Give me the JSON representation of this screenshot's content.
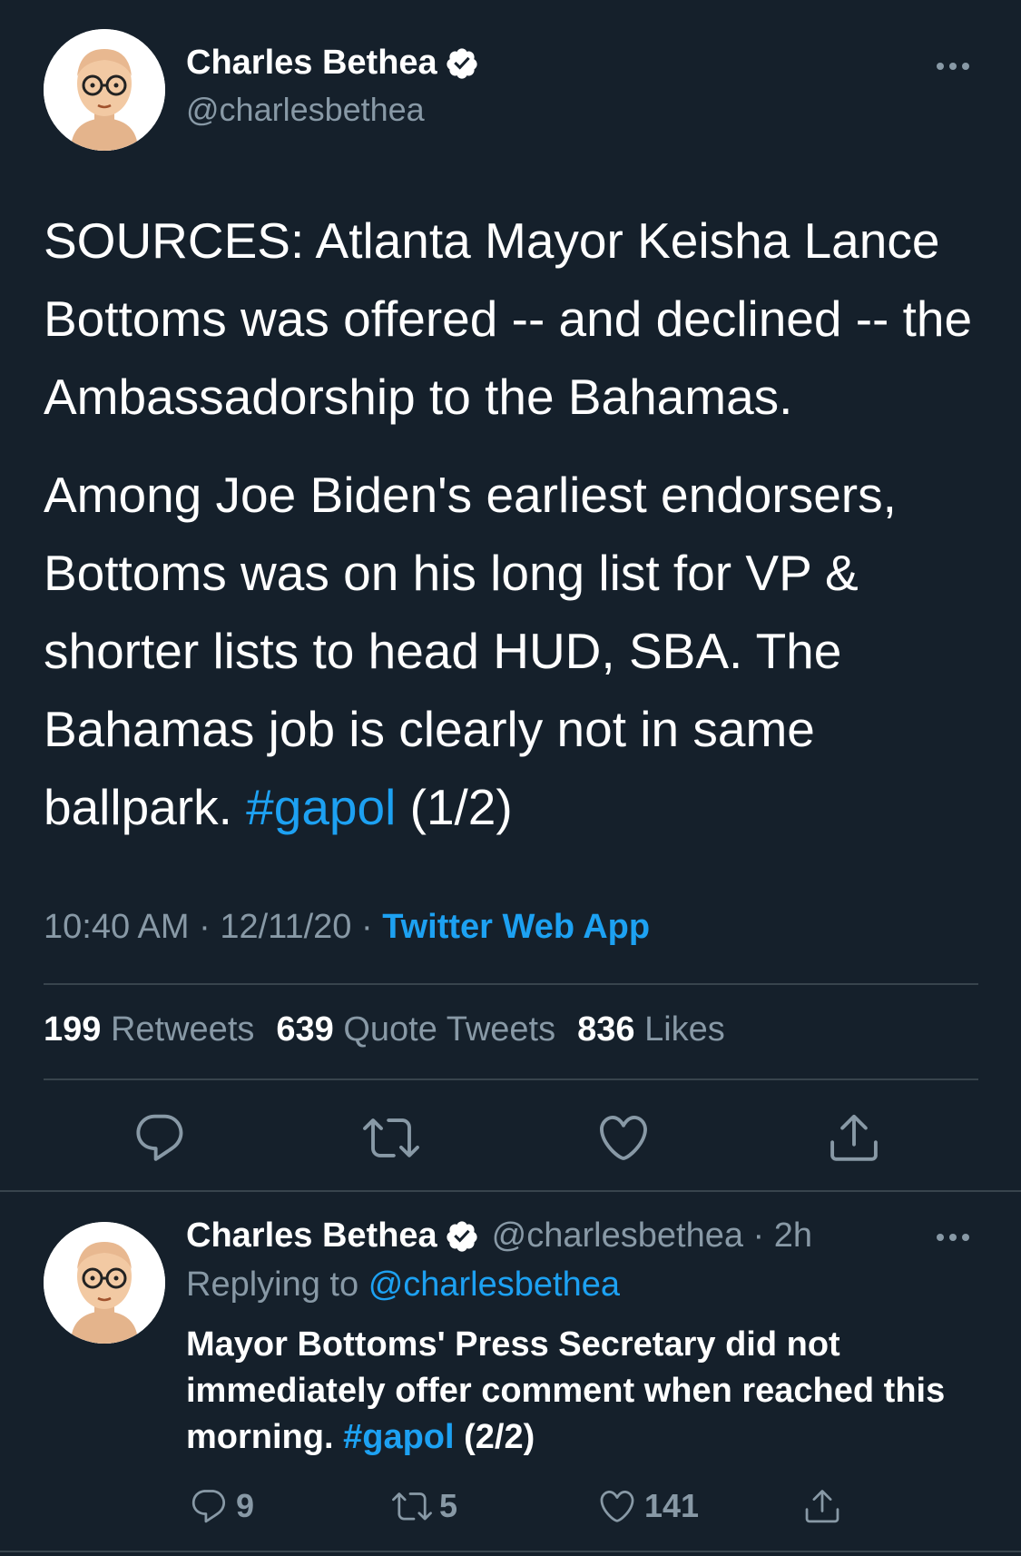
{
  "colors": {
    "background": "#15202b",
    "primary_text": "#ffffff",
    "secondary_text": "#8899a6",
    "accent": "#1da1f2",
    "divider": "#38444d"
  },
  "main_tweet": {
    "display_name": "Charles Bethea",
    "handle": "@charlesbethea",
    "verified_icon": "verified-badge-icon",
    "more_icon": "more-options-icon",
    "paragraph1": "SOURCES: Atlanta Mayor Keisha Lance Bottoms was offered -- and declined -- the Ambassadorship to the Bahamas.",
    "paragraph2_text": "Among Joe Biden's earliest endorsers, Bottoms was on his long list for VP & shorter lists to head HUD, SBA. The Bahamas job is clearly not in same ballpark.",
    "paragraph2_hashtag": "#gapol",
    "paragraph2_suffix": "(1/2)",
    "time": "10:40 AM",
    "date": "12/11/20",
    "separator": "·",
    "source_app": "Twitter Web App",
    "stats": {
      "retweets_count": "199",
      "retweets_label": "Retweets",
      "quotes_count": "639",
      "quotes_label": "Quote Tweets",
      "likes_count": "836",
      "likes_label": "Likes"
    },
    "actions": [
      "reply-icon",
      "retweet-icon",
      "like-icon",
      "share-icon"
    ]
  },
  "reply_tweet": {
    "display_name": "Charles Bethea",
    "handle_time": "@charlesbethea · 2h",
    "replying_prefix": "Replying to",
    "replying_to": "@charlesbethea",
    "body_text": "Mayor Bottoms' Press Secretary did not immediately offer comment when reached this morning.",
    "body_hashtag": "#gapol",
    "body_suffix": "(2/2)",
    "reply_count": "9",
    "retweet_count": "5",
    "like_count": "141"
  }
}
